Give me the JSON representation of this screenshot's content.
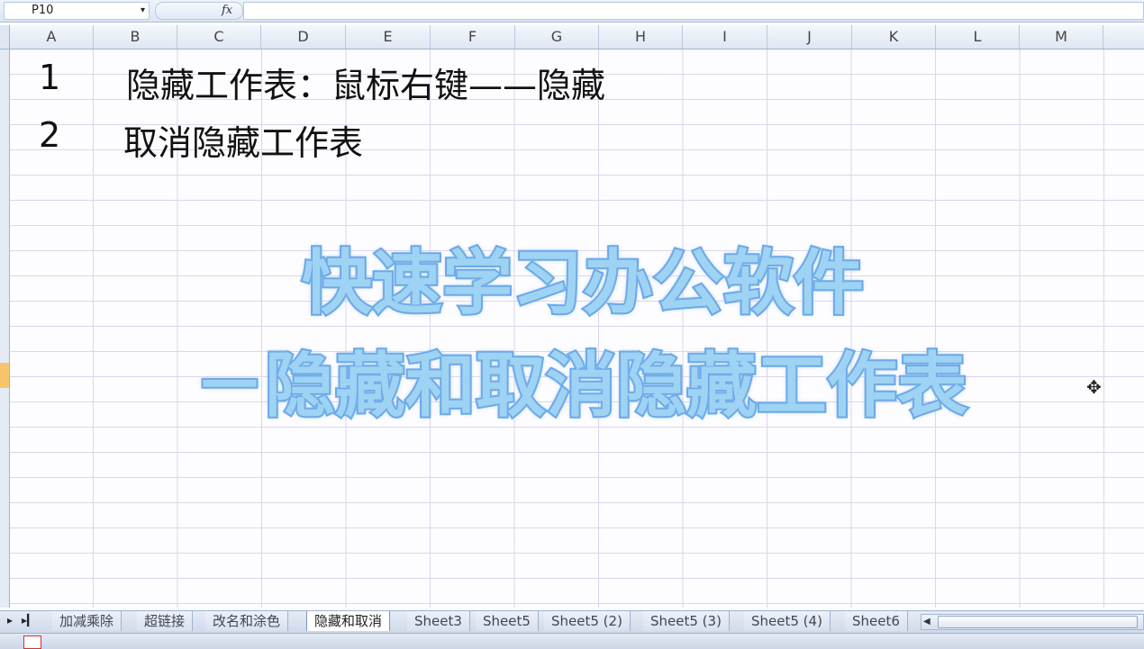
{
  "namebox": {
    "value": "P10",
    "dropdown_glyph": "▾"
  },
  "formula_bar": {
    "fx_label": "fx",
    "value": ""
  },
  "columns": [
    "A",
    "B",
    "C",
    "D",
    "E",
    "F",
    "G",
    "H",
    "I",
    "J",
    "K",
    "L",
    "M"
  ],
  "cells": {
    "a1": "1",
    "b1": "隐藏工作表：鼠标右键——隐藏",
    "a2": "2",
    "b2": "取消隐藏工作表"
  },
  "overlay": {
    "line1": "快速学习办公软件",
    "line2": "－隐藏和取消隐藏工作表"
  },
  "cursor_glyph": "✥",
  "sheet_nav": {
    "next": "▸",
    "last": "▸▎"
  },
  "sheet_tabs": [
    "加减乘除",
    "超链接",
    "改名和涂色",
    "隐藏和取消",
    "Sheet3",
    "Sheet5",
    "Sheet5 (2)",
    "Sheet5 (3)",
    "Sheet5 (4)",
    "Sheet6"
  ],
  "selected_tab": "隐藏和取消",
  "scroll_arrow": "◀",
  "colors": {
    "overlay_fill": "#9fd3f3",
    "overlay_stroke": "#6aa8e6",
    "active_row": "#f7c46b"
  }
}
